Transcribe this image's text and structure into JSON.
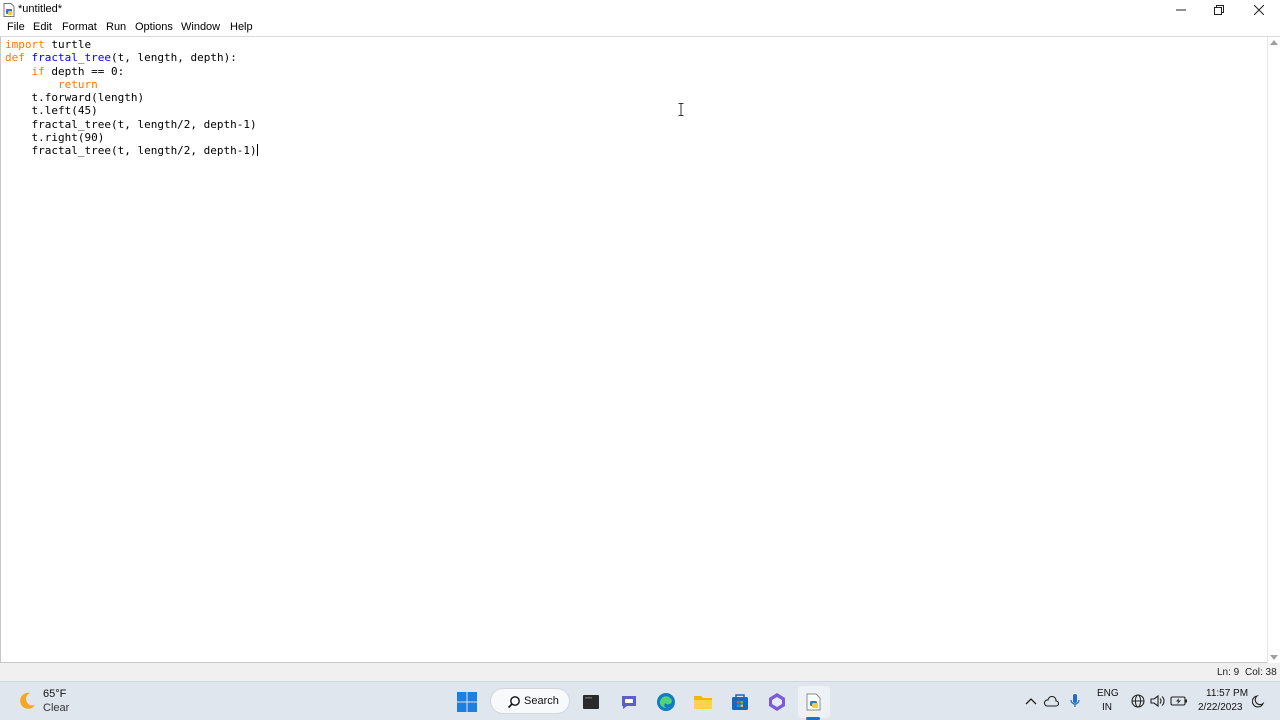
{
  "window": {
    "title": "*untitled*"
  },
  "menu": {
    "items": [
      "File",
      "Edit",
      "Format",
      "Run",
      "Options",
      "Window",
      "Help"
    ]
  },
  "editor": {
    "lines": [
      [
        {
          "t": "import",
          "c": "kw"
        },
        {
          "t": " turtle",
          "c": ""
        }
      ],
      [
        {
          "t": "def",
          "c": "kw"
        },
        {
          "t": " ",
          "c": ""
        },
        {
          "t": "fractal_tree",
          "c": "fn"
        },
        {
          "t": "(t, length, depth):",
          "c": ""
        }
      ],
      [
        {
          "t": "    ",
          "c": ""
        },
        {
          "t": "if",
          "c": "kw"
        },
        {
          "t": " depth == 0:",
          "c": ""
        }
      ],
      [
        {
          "t": "        ",
          "c": ""
        },
        {
          "t": "return",
          "c": "kw"
        }
      ],
      [
        {
          "t": "    t.forward(length)",
          "c": ""
        }
      ],
      [
        {
          "t": "    t.left(45)",
          "c": ""
        }
      ],
      [
        {
          "t": "    fractal_tree(t, length/2, depth-1)",
          "c": ""
        }
      ],
      [
        {
          "t": "    t.right(90)",
          "c": ""
        }
      ],
      [
        {
          "t": "    fractal_tree(t, length/2, depth-1)",
          "c": ""
        }
      ]
    ]
  },
  "status": {
    "line": "Ln: 9",
    "column": "Col: 38"
  },
  "taskbar": {
    "weather_temp": "65°F",
    "weather_condition": "Clear",
    "search_label": "Search",
    "pinned_icons": [
      "windows-start-icon",
      "search-icon",
      "file-explorer-dark-icon",
      "teams-chat-icon",
      "edge-browser-icon",
      "file-explorer-icon",
      "microsoft-store-icon",
      "copilot-app-icon",
      "python-idle-icon"
    ],
    "language_line1": "ENG",
    "language_line2": "IN",
    "time": "11:57 PM",
    "date": "2/22/2023"
  }
}
